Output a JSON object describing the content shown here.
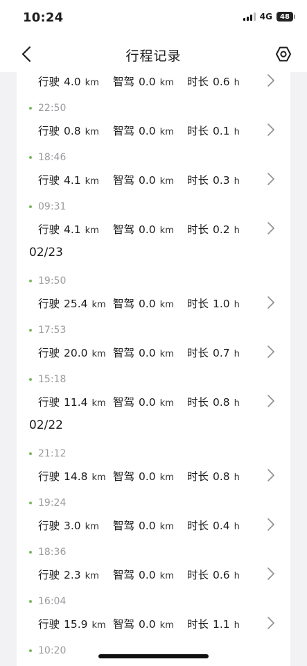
{
  "status_bar": {
    "time": "10:24",
    "network": "4G",
    "battery": "48"
  },
  "nav": {
    "title": "行程记录",
    "back_icon": "chevron-left-icon",
    "settings_icon": "hexagon-settings-icon"
  },
  "labels": {
    "distance": "行驶",
    "assisted": "智驾",
    "duration": "时长",
    "km": "km",
    "h": "h"
  },
  "groups": [
    {
      "date": "",
      "trips": [
        {
          "time": "",
          "distance": "4.0",
          "assisted": "0.0",
          "duration": "0.6"
        },
        {
          "time": "22:50",
          "distance": "0.8",
          "assisted": "0.0",
          "duration": "0.1"
        },
        {
          "time": "18:46",
          "distance": "4.1",
          "assisted": "0.0",
          "duration": "0.3"
        },
        {
          "time": "09:31",
          "distance": "4.1",
          "assisted": "0.0",
          "duration": "0.2"
        }
      ]
    },
    {
      "date": "02/23",
      "trips": [
        {
          "time": "19:50",
          "distance": "25.4",
          "assisted": "0.0",
          "duration": "1.0"
        },
        {
          "time": "17:53",
          "distance": "20.0",
          "assisted": "0.0",
          "duration": "0.7"
        },
        {
          "time": "15:18",
          "distance": "11.4",
          "assisted": "0.0",
          "duration": "0.8"
        }
      ]
    },
    {
      "date": "02/22",
      "trips": [
        {
          "time": "21:12",
          "distance": "14.8",
          "assisted": "0.0",
          "duration": "0.8"
        },
        {
          "time": "19:24",
          "distance": "3.0",
          "assisted": "0.0",
          "duration": "0.4"
        },
        {
          "time": "18:36",
          "distance": "2.3",
          "assisted": "0.0",
          "duration": "0.6"
        },
        {
          "time": "16:04",
          "distance": "15.9",
          "assisted": "0.0",
          "duration": "1.1"
        },
        {
          "time": "10:20",
          "distance": "",
          "assisted": "",
          "duration": ""
        }
      ]
    }
  ],
  "colors": {
    "dot": "#7bb661",
    "time_text": "#9a9a9f",
    "page_bg": "#f2f2f4"
  }
}
